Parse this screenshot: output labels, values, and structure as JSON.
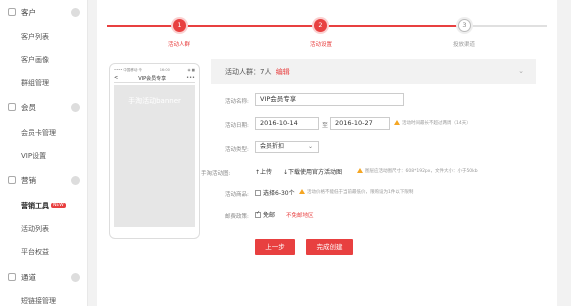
{
  "sidebar": {
    "sections": [
      {
        "label": "客户",
        "icon": "customer-icon",
        "items": [
          "客户列表",
          "客户画像",
          "群组管理"
        ]
      },
      {
        "label": "会员",
        "icon": "member-icon",
        "items": [
          "会员卡管理",
          "VIP设置"
        ]
      },
      {
        "label": "营销",
        "icon": "marketing-icon",
        "items": [
          "营销工具",
          "活动列表",
          "平台权益"
        ],
        "new_badge": "NEW"
      },
      {
        "label": "通道",
        "icon": "channel-icon",
        "items": [
          "短链接管理"
        ]
      }
    ]
  },
  "steps": [
    {
      "num": "1",
      "label": "活动人群",
      "state": "done"
    },
    {
      "num": "2",
      "label": "活动设置",
      "state": "done"
    },
    {
      "num": "3",
      "label": "投放渠道",
      "state": "todo"
    }
  ],
  "phone": {
    "status_left": "•••• 中国移动 令",
    "status_center": "16:00",
    "status_right": "◉ ■",
    "title": "VIP会员专享",
    "back_symbol": "<",
    "more_symbol": "•••",
    "banner_text": "手淘活动banner"
  },
  "form": {
    "header": {
      "text": "活动人群：7人",
      "edit": "编辑"
    },
    "name": {
      "label": "活动名称:",
      "value": "VIP会员专享"
    },
    "date": {
      "label": "活动日期:",
      "start": "2016-10-14",
      "to": "至",
      "end": "2016-10-27",
      "hint": "活动时间最长不超过两周（14天）"
    },
    "type": {
      "label": "活动类型:",
      "value": "会员折扣"
    },
    "image": {
      "label": "手淘活动图:",
      "upload": "上传",
      "download": "下载使用官方活动图",
      "hint": "图层应活动图尺寸：608*192px，文件大小：小于50kb"
    },
    "goods": {
      "label": "活动商品:",
      "select": "选择6-30个",
      "hint": "活动价格不能低于当前最低价，限购设为1件以下限制"
    },
    "shipping": {
      "label": "邮费政策:",
      "free": "免邮",
      "exclude": "不免邮地区"
    },
    "buttons": {
      "prev": "上一步",
      "finish": "完成创建"
    }
  },
  "colors": {
    "accent": "#e84040",
    "warning": "#f5a623"
  }
}
